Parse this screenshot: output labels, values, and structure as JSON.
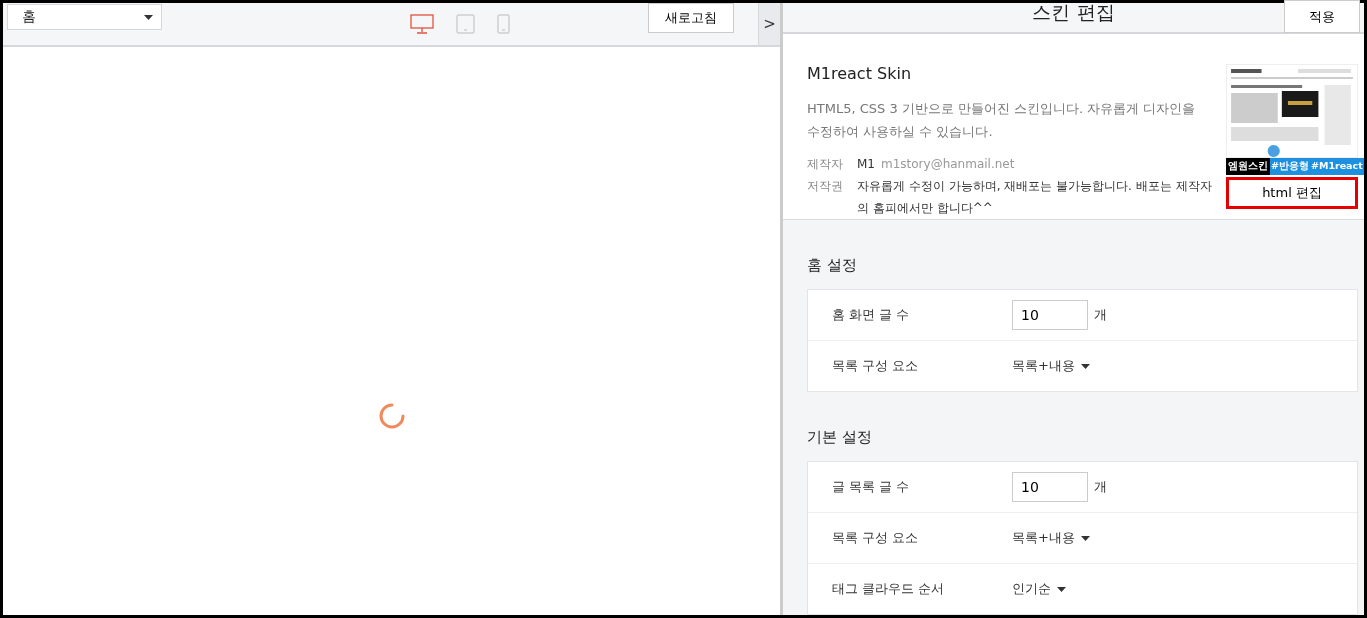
{
  "preview": {
    "page_select": "홈",
    "devices": [
      {
        "kind": "desktop",
        "selected": true
      },
      {
        "kind": "tablet",
        "selected": false
      },
      {
        "kind": "mobile",
        "selected": false
      }
    ],
    "refresh_button": "새로고침",
    "collapse_button": ">"
  },
  "editor": {
    "title": "스킨 편집",
    "apply_button": "적용",
    "skin": {
      "name": "M1react Skin",
      "description": "HTML5, CSS 3 기반으로 만들어진 스킨입니다. 자유롭게 디자인을 수정하여 사용하실 수 있습니다.",
      "author_label": "제작자",
      "author": "M1",
      "author_email": "m1story@hanmail.net",
      "license_label": "저작권",
      "license": "자유롭게 수정이 가능하며, 재배포는 불가능합니다. 배포는 제작자의 홈피에서만 합니다^^",
      "thumbnail": {
        "kind": "picture",
        "tags": [
          "엠원스킨",
          "#반응형",
          "#M1react"
        ]
      },
      "html_edit_button": "html 편집"
    },
    "sections": [
      {
        "title": "홈 설정",
        "rows": [
          {
            "kind": "number",
            "label": "홈 화면 글 수",
            "value": "10",
            "unit": "개"
          },
          {
            "kind": "select",
            "label": "목록 구성 요소",
            "value": "목록+내용"
          }
        ]
      },
      {
        "title": "기본 설정",
        "rows": [
          {
            "kind": "number",
            "label": "글 목록 글 수",
            "value": "10",
            "unit": "개"
          },
          {
            "kind": "select",
            "label": "목록 구성 요소",
            "value": "목록+내용"
          },
          {
            "kind": "select",
            "label": "태그 클라우드 순서",
            "value": "인기순"
          }
        ]
      }
    ]
  }
}
